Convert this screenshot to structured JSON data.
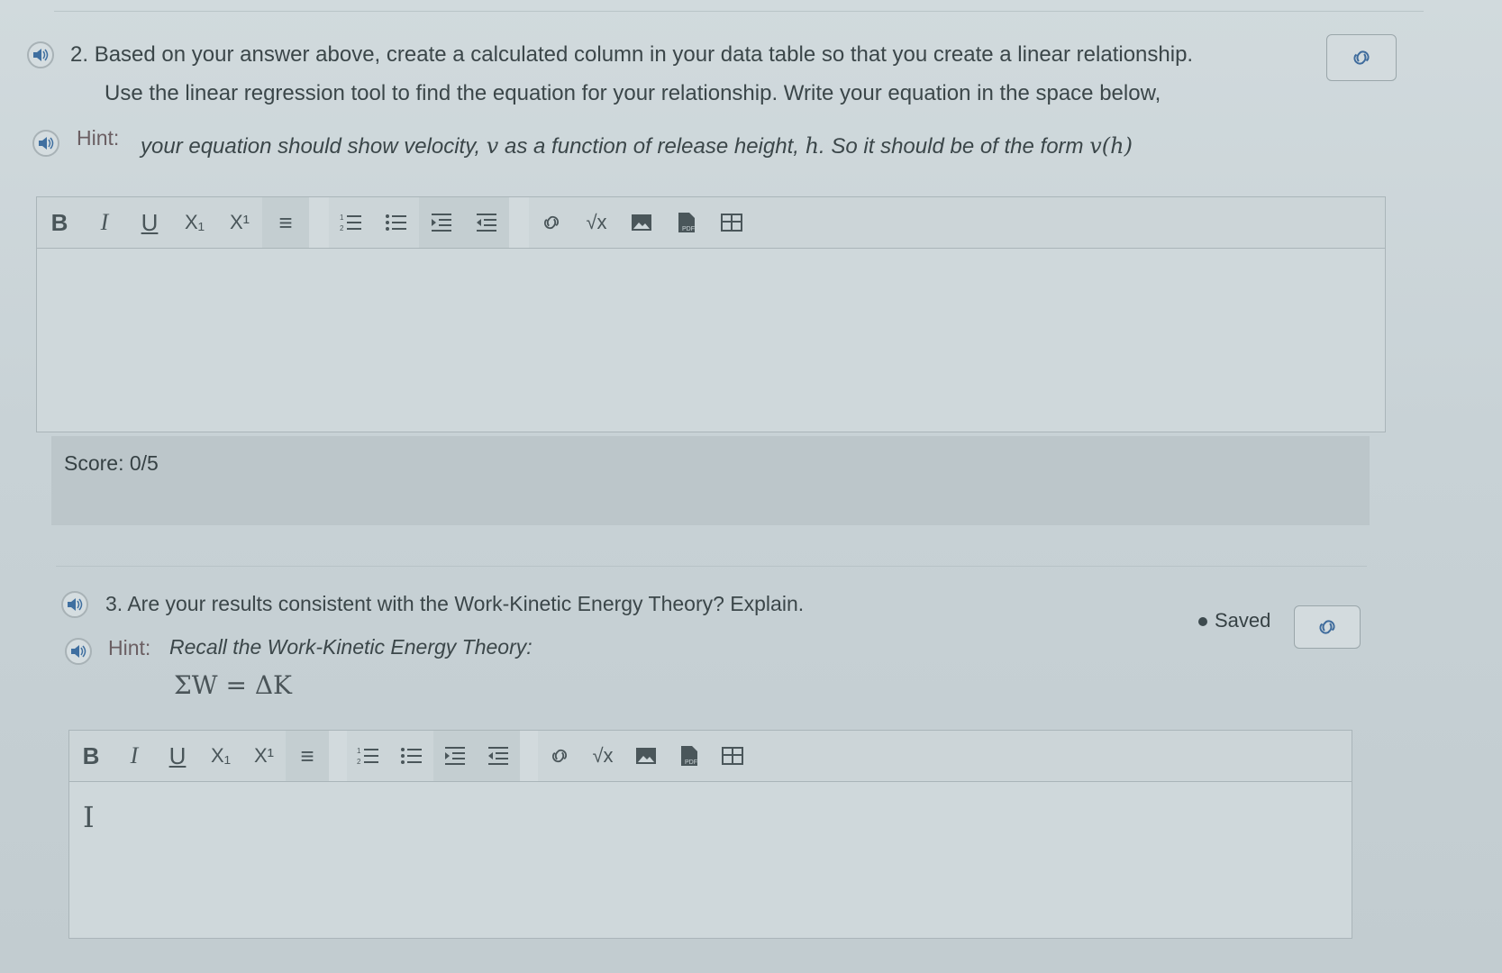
{
  "question2": {
    "number": "2.",
    "line1": "Based on your answer above, create a calculated column in your data table so that you create a linear relationship.",
    "line2": "Use the linear regression tool to find the equation for your relationship. Write your equation in the space below,",
    "hint_label": "Hint:",
    "hint_part1": "your equation should show velocity,",
    "hint_var_v": "v",
    "hint_part2": "as a function of release height,",
    "hint_var_h": "h",
    "hint_part3": ". So it should be of the form",
    "hint_func": "v(h)"
  },
  "toolbar": {
    "bold": "B",
    "italic": "I",
    "underline": "U",
    "subscript": "X₁",
    "superscript": "X¹",
    "align": "≡",
    "sqrt": "√x"
  },
  "score": {
    "label": "Score:",
    "value": "0/5"
  },
  "question3": {
    "number": "3.",
    "text": "Are your results consistent with the Work-Kinetic Energy Theory? Explain.",
    "hint_label": "Hint:",
    "hint_text": "Recall the Work-Kinetic Energy Theory:",
    "formula": "ΣW = ΔK"
  },
  "status": {
    "saved": "Saved"
  },
  "cursor": "I"
}
